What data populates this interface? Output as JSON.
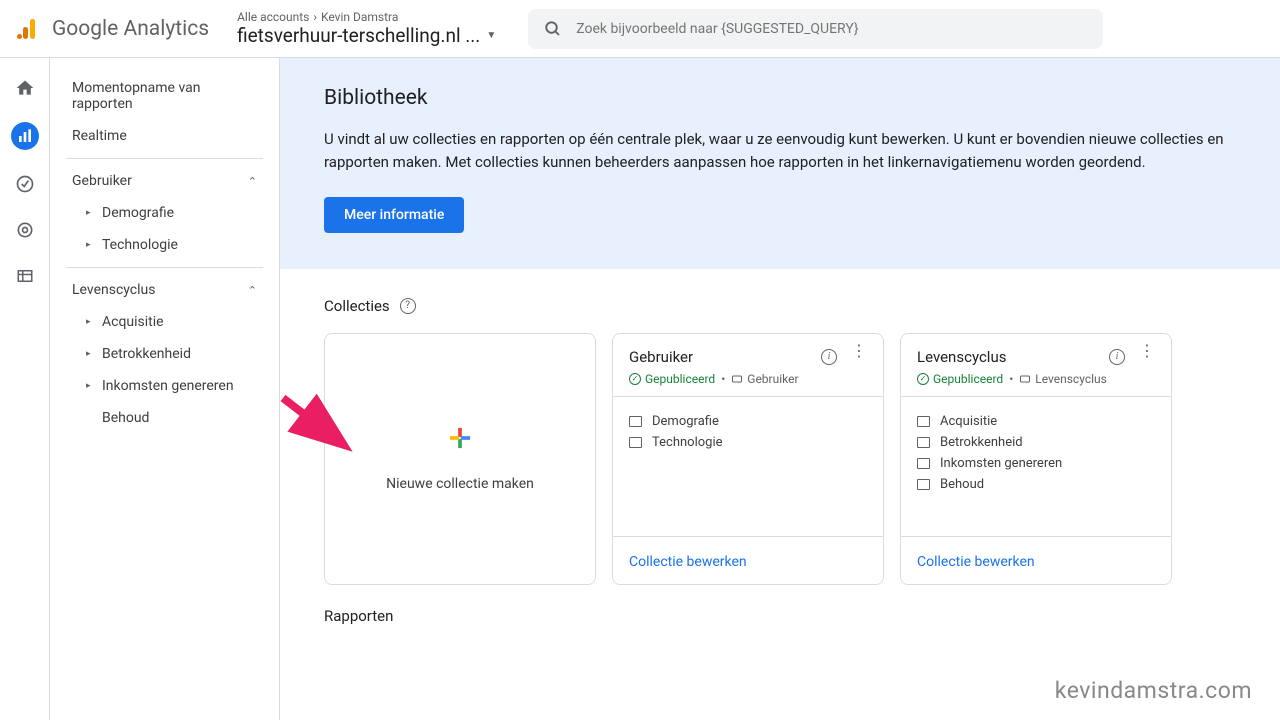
{
  "header": {
    "product": "Google Analytics",
    "breadcrumb_parent": "Alle accounts",
    "breadcrumb_child": "Kevin Damstra",
    "property": "fietsverhuur-terschelling.nl ...",
    "search_placeholder": "Zoek bijvoorbeeld naar {SUGGESTED_QUERY}"
  },
  "sidebar": {
    "top": [
      "Momentopname van rapporten",
      "Realtime"
    ],
    "sections": [
      {
        "label": "Gebruiker",
        "items": [
          "Demografie",
          "Technologie"
        ]
      },
      {
        "label": "Levenscyclus",
        "items": [
          "Acquisitie",
          "Betrokkenheid",
          "Inkomsten genereren",
          "Behoud"
        ]
      }
    ]
  },
  "banner": {
    "title": "Bibliotheek",
    "text": "U vindt al uw collecties en rapporten op één centrale plek, waar u ze eenvoudig kunt bewerken. U kunt er bovendien nieuwe collecties en rapporten maken. Met collecties kunnen beheerders aanpassen hoe rapporten in het linkernavigatiemenu worden geordend.",
    "button": "Meer informatie"
  },
  "collections": {
    "heading": "Collecties",
    "new_label": "Nieuwe collectie maken",
    "cards": [
      {
        "title": "Gebruiker",
        "status": "Gepubliceerd",
        "tag": "Gebruiker",
        "items": [
          "Demografie",
          "Technologie"
        ],
        "edit": "Collectie bewerken"
      },
      {
        "title": "Levenscyclus",
        "status": "Gepubliceerd",
        "tag": "Levenscyclus",
        "items": [
          "Acquisitie",
          "Betrokkenheid",
          "Inkomsten genereren",
          "Behoud"
        ],
        "edit": "Collectie bewerken"
      }
    ]
  },
  "reports": {
    "heading": "Rapporten"
  },
  "watermark": "kevindamstra.com"
}
